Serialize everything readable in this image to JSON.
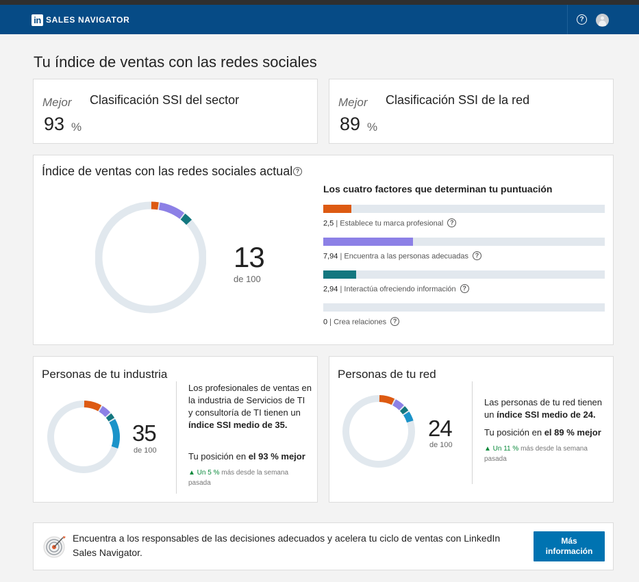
{
  "navbar": {
    "logo_text": "in",
    "brand": "SALES NAVIGATOR",
    "help_icon_glyph": "?"
  },
  "page_title": "Tu índice de ventas con las redes sociales",
  "rank_cards": [
    {
      "label": "Mejor",
      "title": "Clasificación SSI del sector",
      "value": "93",
      "unit": "%"
    },
    {
      "label": "Mejor",
      "title": "Clasificación SSI de la red",
      "value": "89",
      "unit": "%"
    }
  ],
  "ssi": {
    "title": "Índice de ventas con las redes sociales actual",
    "score": "13",
    "score_of": "de 100",
    "factors_title": "Los cuatro factores que determinan tu puntuación",
    "factors": [
      {
        "value": "2,5",
        "label": "Establece tu marca profesional",
        "score": 2.5,
        "max": 25,
        "color": "#dd5a12"
      },
      {
        "value": "7,94",
        "label": "Encuentra a las personas adecuadas",
        "score": 7.94,
        "max": 25,
        "color": "#8c80e6"
      },
      {
        "value": "2,94",
        "label": "Interactúa ofreciendo información",
        "score": 2.94,
        "max": 25,
        "color": "#13777f"
      },
      {
        "value": "0",
        "label": "Crea relaciones",
        "score": 0,
        "max": 25,
        "color": "#1b93c9"
      }
    ]
  },
  "industry": {
    "title": "Personas de tu industria",
    "score": "35",
    "score_of": "de 100",
    "text_before": "Los profesionales de ventas en la industria de Servicios de TI y consultoría de TI tienen un ",
    "text_bold": "índice SSI medio de 35.",
    "position_before": "Tu posición en ",
    "position_bold": "el 93 % mejor",
    "trend_up": "▲ Un 5 %",
    "trend_rest": " más desde la semana pasada",
    "segments": [
      8.5,
      5,
      3,
      14
    ]
  },
  "network": {
    "title": "Personas de tu red",
    "score": "24",
    "score_of": "de 100",
    "text_before": "Las personas de tu red tienen un ",
    "text_bold": "índice SSI medio de 24.",
    "position_before": "Tu posición en ",
    "position_bold": "el 89 % mejor",
    "trend_up": "▲ Un 11 %",
    "trend_rest": " más desde la semana pasada",
    "segments": [
      7.5,
      5,
      3,
      5
    ]
  },
  "banner": {
    "text": "Encuentra a los responsables de las decisiones adecuados y acelera tu ciclo de ventas con LinkedIn Sales Navigator.",
    "button_line1": "Más",
    "button_line2": "información"
  },
  "colors": {
    "navbar": "#064b86",
    "track": "#e1e8ee",
    "brand_pillar": "#dd5a12",
    "find_pillar": "#8c80e6",
    "engage_pillar": "#13777f",
    "relate_pillar": "#1b93c9",
    "cta": "#0073b1"
  }
}
